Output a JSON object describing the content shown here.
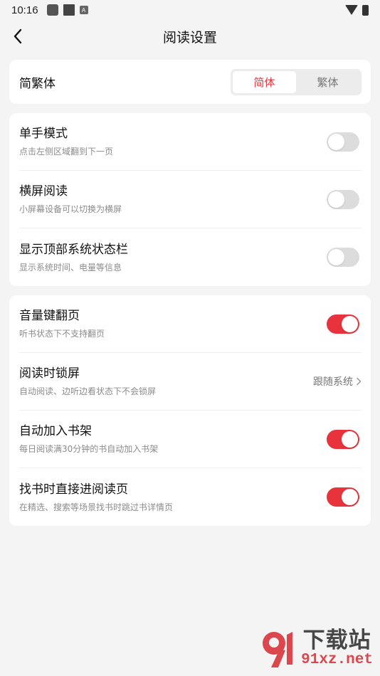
{
  "status_bar": {
    "time": "10:16",
    "icon_a": "A"
  },
  "nav": {
    "title": "阅读设置"
  },
  "language": {
    "label": "简繁体",
    "options": [
      "简体",
      "繁体"
    ],
    "selected": "简体"
  },
  "group1": {
    "rows": [
      {
        "title": "单手模式",
        "subtitle": "点击左侧区域翻到下一页",
        "enabled": false
      },
      {
        "title": "横屏阅读",
        "subtitle": "小屏幕设备可以切换为横屏",
        "enabled": false
      },
      {
        "title": "显示顶部系统状态栏",
        "subtitle": "显示系统时间、电量等信息",
        "enabled": false
      }
    ]
  },
  "group2": {
    "rows": [
      {
        "title": "音量键翻页",
        "subtitle": "听书状态下不支持翻页",
        "enabled": true
      },
      {
        "title": "阅读时锁屏",
        "subtitle": "自动阅读、边听边看状态下不会锁屏",
        "value": "跟随系统"
      },
      {
        "title": "自动加入书架",
        "subtitle": "每日阅读满30分钟的书自动加入书架",
        "enabled": true
      },
      {
        "title": "找书时直接进阅读页",
        "subtitle": "在精选、搜索等场景找书时跳过书详情页",
        "enabled": true
      }
    ]
  },
  "watermark": {
    "name": "下载站",
    "url": "91xz.net",
    "logo_text": "91"
  },
  "colors": {
    "accent": "#e8333c",
    "background": "#f4f4f4",
    "card": "#ffffff"
  }
}
